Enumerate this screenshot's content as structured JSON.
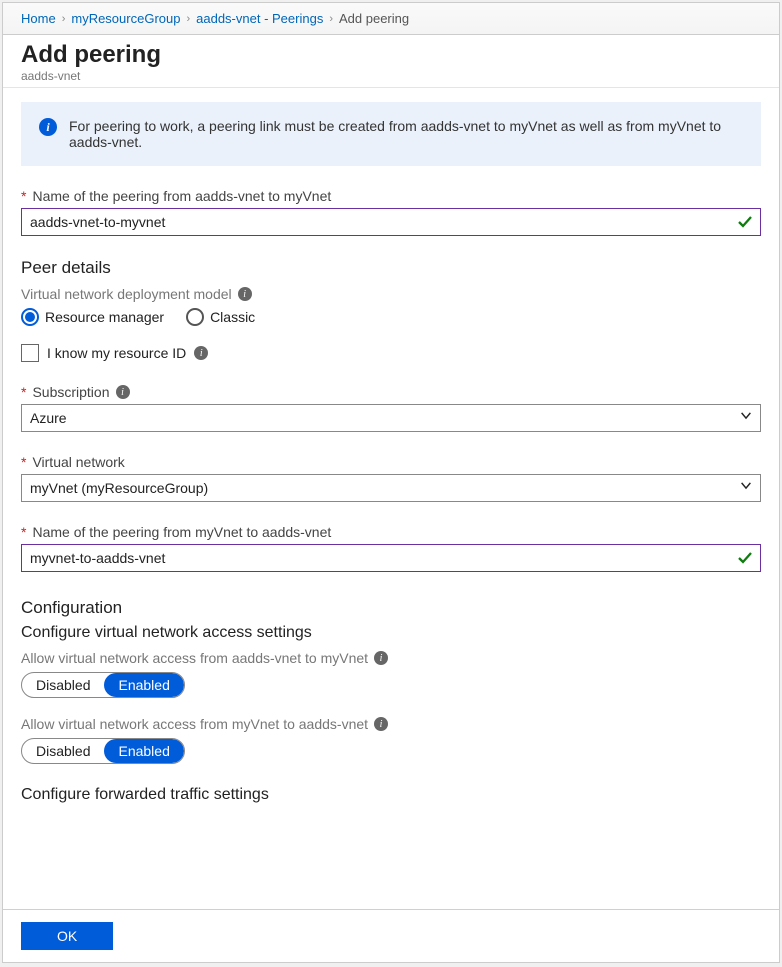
{
  "breadcrumb": {
    "home": "Home",
    "group": "myResourceGroup",
    "vnet": "aadds-vnet - Peerings",
    "current": "Add peering"
  },
  "header": {
    "title": "Add peering",
    "subtitle": "aadds-vnet"
  },
  "info": {
    "text": "For peering to work, a peering link must be created from aadds-vnet to myVnet as well as from myVnet to aadds-vnet."
  },
  "fields": {
    "name1_label": "Name of the peering from aadds-vnet to myVnet",
    "name1_value": "aadds-vnet-to-myvnet",
    "peer_details": "Peer details",
    "deploy_model": "Virtual network deployment model",
    "opt_rm": "Resource manager",
    "opt_classic": "Classic",
    "know_id": "I know my resource ID",
    "subscription_label": "Subscription",
    "subscription_value": "Azure",
    "vnet_label": "Virtual network",
    "vnet_value": "myVnet (myResourceGroup)",
    "name2_label": "Name of the peering from myVnet to aadds-vnet",
    "name2_value": "myvnet-to-aadds-vnet",
    "config": "Configuration",
    "config_access": "Configure virtual network access settings",
    "allow1": "Allow virtual network access from aadds-vnet to myVnet",
    "allow2": "Allow virtual network access from myVnet to aadds-vnet",
    "disabled": "Disabled",
    "enabled": "Enabled",
    "fwd": "Configure forwarded traffic settings"
  },
  "footer": {
    "ok": "OK"
  }
}
